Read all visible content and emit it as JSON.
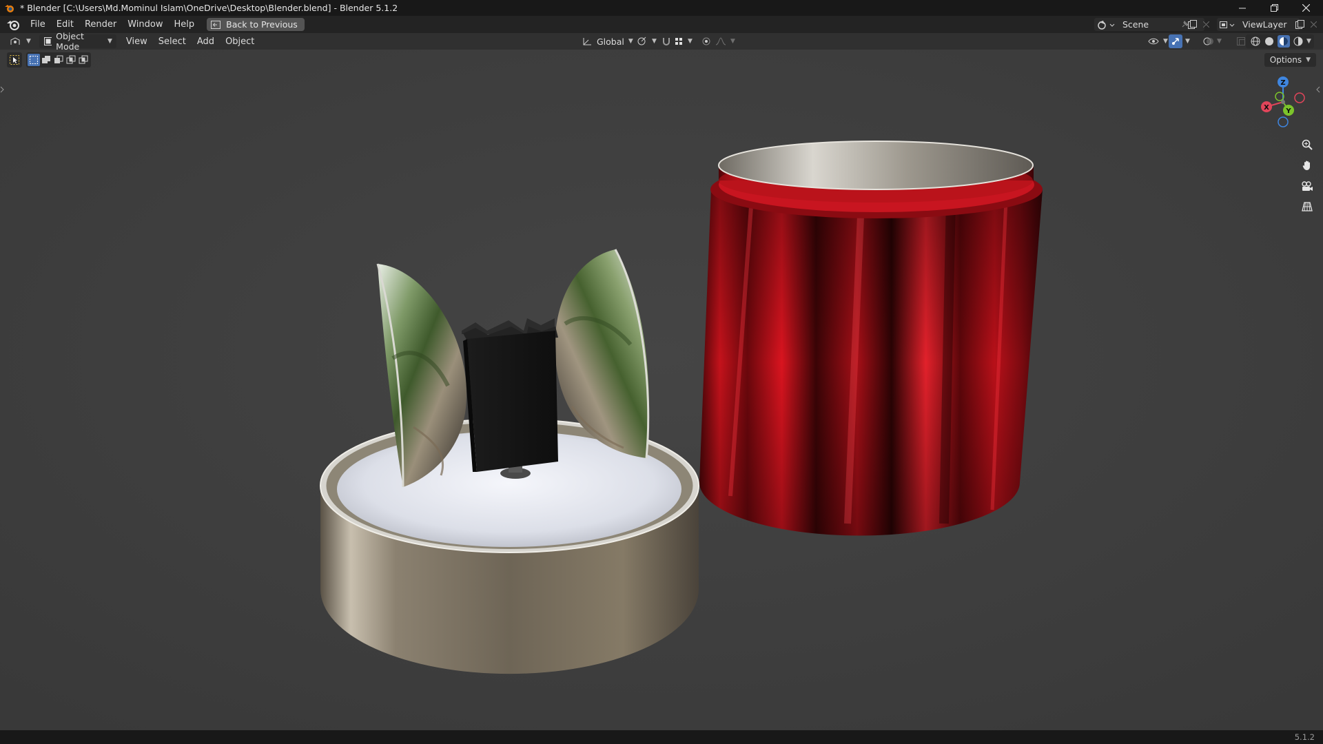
{
  "window": {
    "title": "* Blender [C:\\Users\\Md.Mominul Islam\\OneDrive\\Desktop\\Blender.blend] - Blender 5.1.2",
    "controls": [
      "minimize",
      "restore",
      "close"
    ]
  },
  "menubar": {
    "items": [
      "File",
      "Edit",
      "Render",
      "Window",
      "Help"
    ],
    "back_button": "Back to Previous",
    "scene_label": "Scene",
    "view_layer_label": "ViewLayer"
  },
  "viewport_header": {
    "mode": "Object Mode",
    "menus": [
      "View",
      "Select",
      "Add",
      "Object"
    ],
    "transform_orientation": "Global"
  },
  "toolbar": {
    "options_label": "Options"
  },
  "gizmo": {
    "axes": [
      "X",
      "Y",
      "Z"
    ],
    "colors": {
      "x": "#e0455a",
      "y": "#7cc42b",
      "z": "#3f86e0"
    }
  },
  "colors": {
    "accent": "#4772b3",
    "background": "#3d3d3d"
  },
  "statusbar": {
    "version": "5.1.2"
  }
}
